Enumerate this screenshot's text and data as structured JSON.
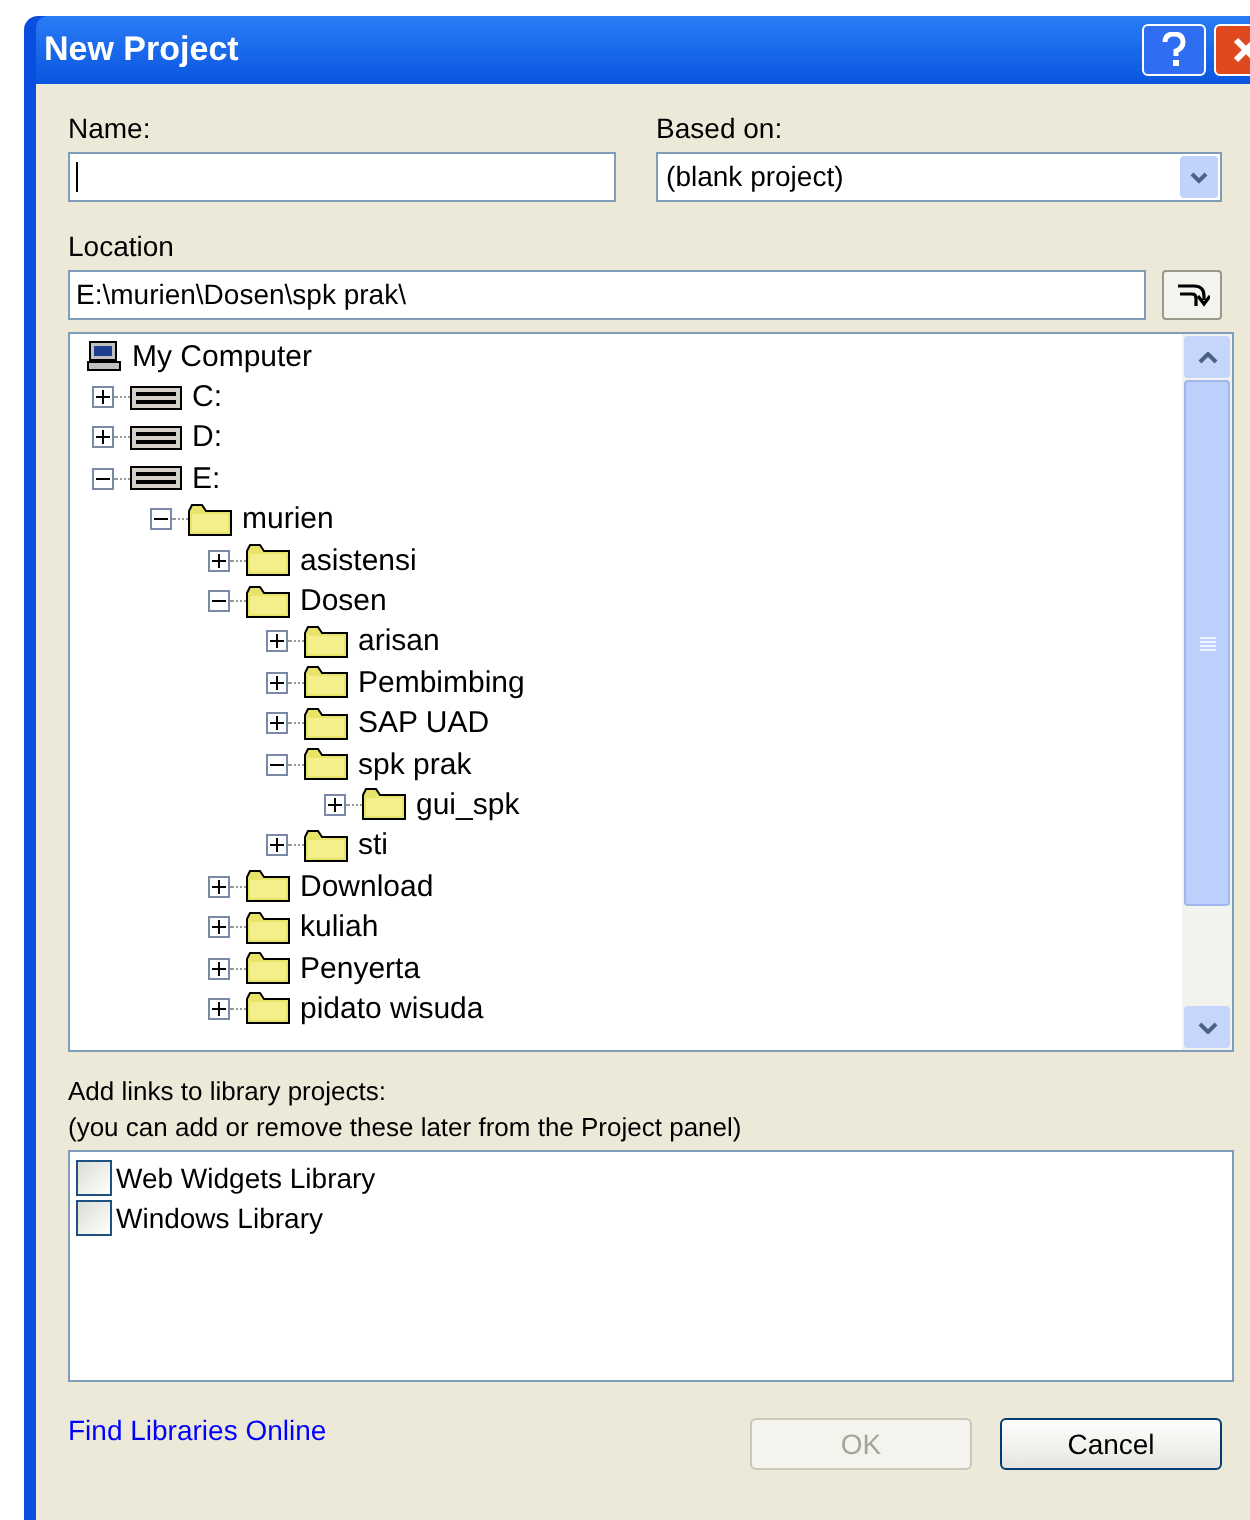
{
  "window": {
    "title": "New Project"
  },
  "name_field": {
    "label": "Name:"
  },
  "based_on": {
    "label": "Based on:",
    "value": "(blank project)"
  },
  "location": {
    "label": "Location",
    "value": "E:\\murien\\Dosen\\spk prak\\"
  },
  "tree": [
    {
      "label": "My Computer",
      "kind": "computer",
      "children": [
        {
          "label": "C:",
          "kind": "drive",
          "expanded": false
        },
        {
          "label": "D:",
          "kind": "drive",
          "expanded": false
        },
        {
          "label": "E:",
          "kind": "drive",
          "expanded": true,
          "children": [
            {
              "label": "murien",
              "kind": "folder",
              "expanded": true,
              "children": [
                {
                  "label": "asistensi",
                  "kind": "folder",
                  "expanded": false
                },
                {
                  "label": "Dosen",
                  "kind": "folder",
                  "expanded": true,
                  "children": [
                    {
                      "label": "arisan",
                      "kind": "folder",
                      "expanded": false
                    },
                    {
                      "label": "Pembimbing",
                      "kind": "folder",
                      "expanded": false
                    },
                    {
                      "label": "SAP UAD",
                      "kind": "folder",
                      "expanded": false
                    },
                    {
                      "label": "spk prak",
                      "kind": "folder",
                      "expanded": true,
                      "children": [
                        {
                          "label": "gui_spk",
                          "kind": "folder",
                          "expanded": false
                        }
                      ]
                    },
                    {
                      "label": "sti",
                      "kind": "folder",
                      "expanded": false
                    }
                  ]
                },
                {
                  "label": "Download",
                  "kind": "folder",
                  "expanded": false
                },
                {
                  "label": "kuliah",
                  "kind": "folder",
                  "expanded": false
                },
                {
                  "label": "Penyerta",
                  "kind": "folder",
                  "expanded": false
                },
                {
                  "label": "pidato wisuda",
                  "kind": "folder",
                  "expanded": false
                }
              ]
            }
          ]
        }
      ]
    }
  ],
  "libraries": {
    "heading": "Add links to library projects:",
    "note": "(you can add or remove these later from the Project panel)",
    "items": [
      {
        "label": "Web Widgets Library",
        "checked": false
      },
      {
        "label": "Windows Library",
        "checked": false
      }
    ]
  },
  "link": "Find Libraries Online",
  "buttons": [
    {
      "label": "OK",
      "disabled": true
    },
    {
      "label": "Cancel",
      "disabled": false
    }
  ]
}
